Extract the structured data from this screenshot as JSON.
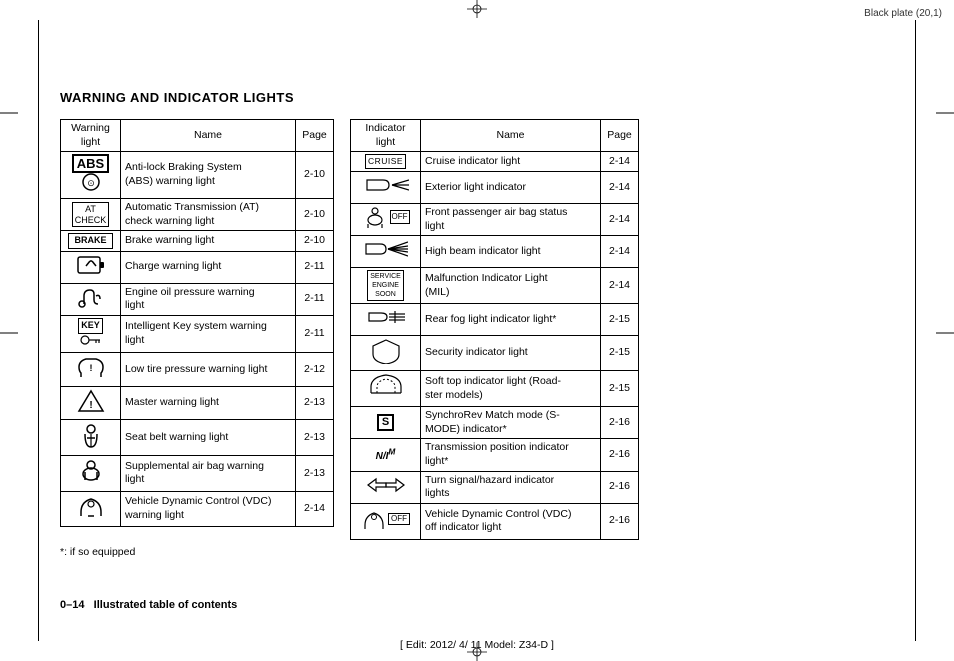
{
  "meta": {
    "top_right": "Black plate (20,1)",
    "bottom_center": "[ Edit: 2012/ 4/ 11   Model: Z34-D ]",
    "bottom_page": "0–14",
    "bottom_label": "Illustrated table of contents"
  },
  "title": "WARNING AND INDICATOR LIGHTS",
  "warning_table": {
    "header": {
      "col1": "Warning\nlight",
      "col2": "Name",
      "col3": "Page"
    },
    "rows": [
      {
        "icon": "ABS",
        "name": "Anti-lock Braking System\n(ABS) warning light",
        "page": "2-10"
      },
      {
        "icon": "AT_CHECK",
        "name": "Automatic Transmission (AT)\ncheck warning light",
        "page": "2-10"
      },
      {
        "icon": "BRAKE",
        "name": "Brake warning light",
        "page": "2-10"
      },
      {
        "icon": "CHARGE",
        "name": "Charge warning light",
        "page": "2-11"
      },
      {
        "icon": "OIL",
        "name": "Engine oil pressure warning\nlight",
        "page": "2-11"
      },
      {
        "icon": "KEY",
        "name": "Intelligent Key system warning\nlight",
        "page": "2-11"
      },
      {
        "icon": "TIRE",
        "name": "Low tire pressure warning light",
        "page": "2-12"
      },
      {
        "icon": "MASTER",
        "name": "Master warning light",
        "page": "2-13"
      },
      {
        "icon": "SEATBELT",
        "name": "Seat belt warning light",
        "page": "2-13"
      },
      {
        "icon": "AIRBAG",
        "name": "Supplemental air bag warning\nlight",
        "page": "2-13"
      },
      {
        "icon": "VDC_WARN",
        "name": "Vehicle Dynamic Control (VDC)\nwarning light",
        "page": "2-14"
      }
    ]
  },
  "indicator_table": {
    "header": {
      "col1": "Indicator\nlight",
      "col2": "Name",
      "col3": "Page"
    },
    "rows": [
      {
        "icon": "CRUISE",
        "name": "Cruise indicator light",
        "page": "2-14"
      },
      {
        "icon": "EXTERIOR",
        "name": "Exterior light indicator",
        "page": "2-14"
      },
      {
        "icon": "FRONT_AIRBAG",
        "name": "Front passenger air bag status\nlight",
        "page": "2-14"
      },
      {
        "icon": "HIGH_BEAM",
        "name": "High beam indicator light",
        "page": "2-14"
      },
      {
        "icon": "MIL",
        "name": "Malfunction Indicator Light\n(MIL)",
        "page": "2-14"
      },
      {
        "icon": "REAR_FOG",
        "name": "Rear fog light indicator light*",
        "page": "2-15"
      },
      {
        "icon": "SECURITY",
        "name": "Security indicator light",
        "page": "2-15"
      },
      {
        "icon": "SOFT_TOP",
        "name": "Soft top indicator light (Road-\nster models)",
        "page": "2-15"
      },
      {
        "icon": "SYNCHRO",
        "name": "SynchroRev Match mode (S-\nMODE) indicator*",
        "page": "2-16"
      },
      {
        "icon": "TRANS_POS",
        "name": "Transmission position indicator\nlight*",
        "page": "2-16"
      },
      {
        "icon": "TURN_SIGNAL",
        "name": "Turn signal/hazard indicator\nlights",
        "page": "2-16"
      },
      {
        "icon": "VDC_OFF",
        "name": "Vehicle Dynamic Control (VDC)\noff indicator light",
        "page": "2-16"
      }
    ]
  },
  "footnote": "*:    if so equipped"
}
